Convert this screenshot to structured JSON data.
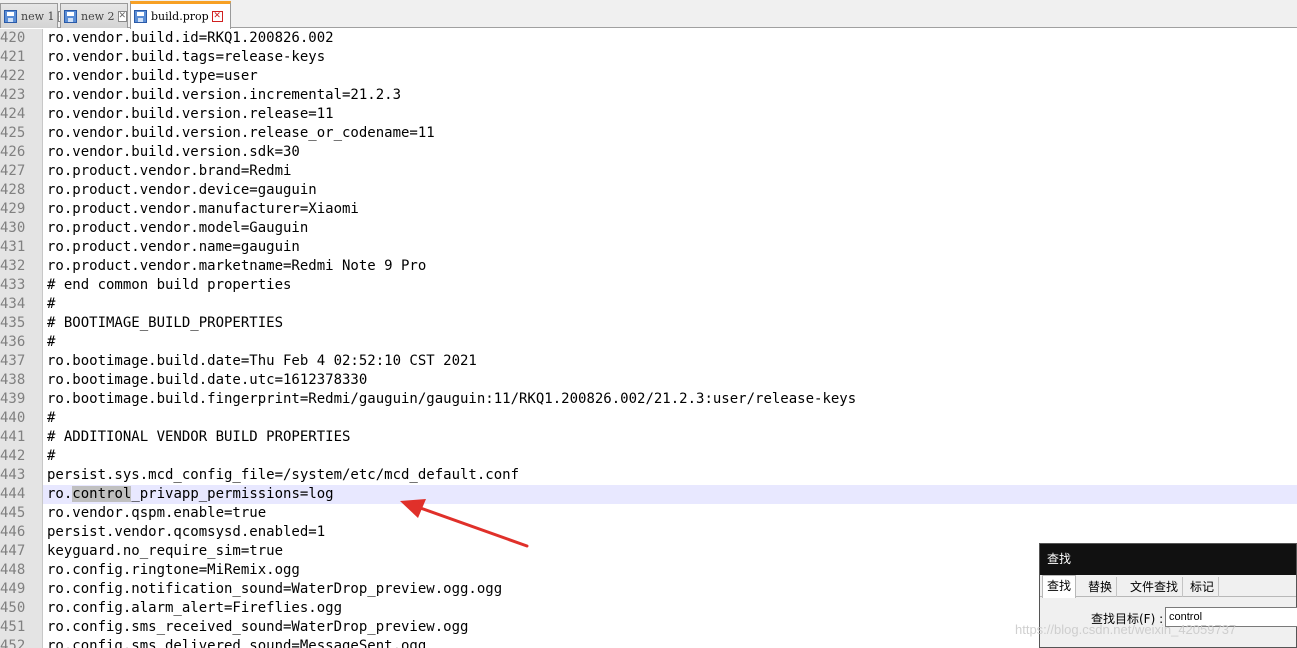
{
  "tabs": [
    {
      "label": "new 1",
      "active": false
    },
    {
      "label": "new 2",
      "active": false
    },
    {
      "label": "build.prop",
      "active": true
    }
  ],
  "lines": [
    {
      "num": "420",
      "text": "ro.vendor.build.id=RKQ1.200826.002"
    },
    {
      "num": "421",
      "text": "ro.vendor.build.tags=release-keys"
    },
    {
      "num": "422",
      "text": "ro.vendor.build.type=user"
    },
    {
      "num": "423",
      "text": "ro.vendor.build.version.incremental=21.2.3"
    },
    {
      "num": "424",
      "text": "ro.vendor.build.version.release=11"
    },
    {
      "num": "425",
      "text": "ro.vendor.build.version.release_or_codename=11"
    },
    {
      "num": "426",
      "text": "ro.vendor.build.version.sdk=30"
    },
    {
      "num": "427",
      "text": "ro.product.vendor.brand=Redmi"
    },
    {
      "num": "428",
      "text": "ro.product.vendor.device=gauguin"
    },
    {
      "num": "429",
      "text": "ro.product.vendor.manufacturer=Xiaomi"
    },
    {
      "num": "430",
      "text": "ro.product.vendor.model=Gauguin"
    },
    {
      "num": "431",
      "text": "ro.product.vendor.name=gauguin"
    },
    {
      "num": "432",
      "text": "ro.product.vendor.marketname=Redmi Note 9 Pro"
    },
    {
      "num": "433",
      "text": "# end common build properties"
    },
    {
      "num": "434",
      "text": "#"
    },
    {
      "num": "435",
      "text": "# BOOTIMAGE_BUILD_PROPERTIES"
    },
    {
      "num": "436",
      "text": "#"
    },
    {
      "num": "437",
      "text": "ro.bootimage.build.date=Thu Feb 4 02:52:10 CST 2021"
    },
    {
      "num": "438",
      "text": "ro.bootimage.build.date.utc=1612378330"
    },
    {
      "num": "439",
      "text": "ro.bootimage.build.fingerprint=Redmi/gauguin/gauguin:11/RKQ1.200826.002/21.2.3:user/release-keys"
    },
    {
      "num": "440",
      "text": "#"
    },
    {
      "num": "441",
      "text": "# ADDITIONAL VENDOR BUILD PROPERTIES"
    },
    {
      "num": "442",
      "text": "#"
    },
    {
      "num": "443",
      "text": "persist.sys.mcd_config_file=/system/etc/mcd_default.conf"
    },
    {
      "num": "444",
      "pre": "ro.",
      "match": "control",
      "post": "_privapp_permissions=log",
      "current": true
    },
    {
      "num": "445",
      "text": "ro.vendor.qspm.enable=true"
    },
    {
      "num": "446",
      "text": "persist.vendor.qcomsysd.enabled=1"
    },
    {
      "num": "447",
      "text": "keyguard.no_require_sim=true"
    },
    {
      "num": "448",
      "text": "ro.config.ringtone=MiRemix.ogg"
    },
    {
      "num": "449",
      "text": "ro.config.notification_sound=WaterDrop_preview.ogg.ogg"
    },
    {
      "num": "450",
      "text": "ro.config.alarm_alert=Fireflies.ogg"
    },
    {
      "num": "451",
      "text": "ro.config.sms_received_sound=WaterDrop_preview.ogg"
    },
    {
      "num": "452",
      "text": "ro.config.sms_delivered_sound=MessageSent.ogg"
    }
  ],
  "find_dialog": {
    "title": "查找",
    "tabs": [
      "查找",
      "替换",
      "文件查找",
      "标记"
    ],
    "label": "查找目标(F) :",
    "value": "control"
  },
  "watermark": "https://blog.csdn.net/weixin_42059737",
  "colors": {
    "active_tab_accent": "#f7a024",
    "current_line": "#e8e8ff",
    "arrow": "#e0302a"
  }
}
